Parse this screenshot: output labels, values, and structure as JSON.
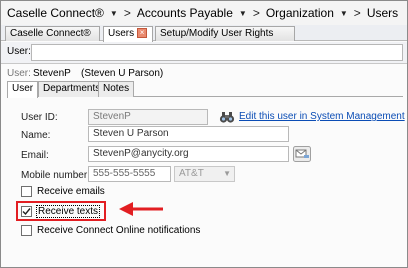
{
  "breadcrumb": {
    "items": [
      "Caselle Connect®",
      "Accounts Payable",
      "Organization",
      "Users"
    ],
    "separator": ">"
  },
  "tabs": [
    {
      "label": "Caselle Connect®"
    },
    {
      "label": "Users",
      "close": "×"
    },
    {
      "label": "Setup/Modify User Rights"
    }
  ],
  "search": {
    "label": "User:",
    "value": ""
  },
  "header": {
    "label": "User:",
    "username": "StevenP",
    "fullname": "(Steven U Parson)"
  },
  "subtabs": [
    "User",
    "Departments",
    "Notes"
  ],
  "form": {
    "user_id": {
      "label": "User ID:",
      "value": "StevenP"
    },
    "edit_link": "Edit this user in System Management",
    "name": {
      "label": "Name:",
      "value": "Steven U Parson"
    },
    "email": {
      "label": "Email:",
      "value": "StevenP@anycity.org"
    },
    "mobile": {
      "label": "Mobile number:",
      "value": "555-555-5555",
      "carrier": "AT&T"
    }
  },
  "checkboxes": [
    {
      "label": "Receive emails",
      "checked": false
    },
    {
      "label": "Receive texts",
      "checked": true
    },
    {
      "label": "Receive Connect Online notifications",
      "checked": false
    }
  ],
  "colors": {
    "highlight": "#e21e22",
    "link": "#0b4db5",
    "arrow": "#e21e22"
  }
}
